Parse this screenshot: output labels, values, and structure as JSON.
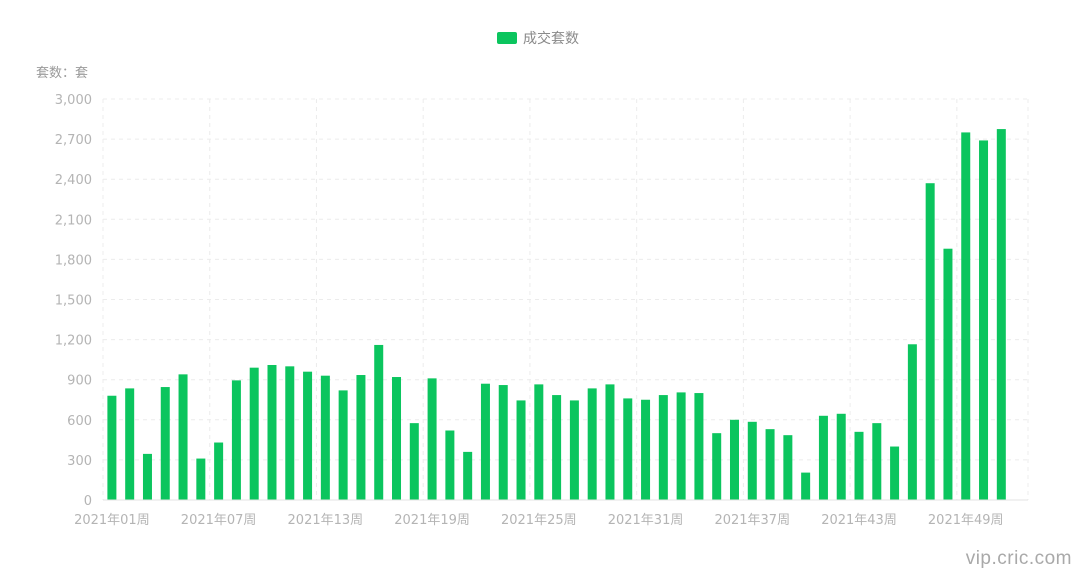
{
  "chart_data": {
    "type": "bar",
    "legend": {
      "label": "成交套数",
      "position": "top-center"
    },
    "unit_label": "套数：套",
    "grid": true,
    "ylim": [
      0,
      3000
    ],
    "y_ticks": [
      "0",
      "300",
      "600",
      "900",
      "1,200",
      "1,500",
      "1,800",
      "2,100",
      "2,400",
      "2,700",
      "3,000"
    ],
    "x_tick_labels": [
      "2021年01周",
      "2021年07周",
      "2021年13周",
      "2021年19周",
      "2021年25周",
      "2021年31周",
      "2021年37周",
      "2021年43周",
      "2021年49周"
    ],
    "categories": [
      "2021年01周",
      "2021年02周",
      "2021年03周",
      "2021年04周",
      "2021年05周",
      "2021年06周",
      "2021年07周",
      "2021年08周",
      "2021年09周",
      "2021年10周",
      "2021年11周",
      "2021年12周",
      "2021年13周",
      "2021年14周",
      "2021年15周",
      "2021年16周",
      "2021年17周",
      "2021年18周",
      "2021年19周",
      "2021年20周",
      "2021年21周",
      "2021年22周",
      "2021年23周",
      "2021年24周",
      "2021年25周",
      "2021年26周",
      "2021年27周",
      "2021年28周",
      "2021年29周",
      "2021年30周",
      "2021年31周",
      "2021年32周",
      "2021年33周",
      "2021年34周",
      "2021年35周",
      "2021年36周",
      "2021年37周",
      "2021年38周",
      "2021年39周",
      "2021年40周",
      "2021年41周",
      "2021年42周",
      "2021年43周",
      "2021年44周",
      "2021年45周",
      "2021年46周",
      "2021年47周",
      "2021年48周",
      "2021年49周",
      "2021年50周",
      "2021年51周",
      "2021年52周"
    ],
    "series": [
      {
        "name": "成交套数",
        "values": [
          780,
          835,
          345,
          845,
          940,
          310,
          430,
          895,
          990,
          1010,
          1000,
          960,
          930,
          820,
          935,
          1160,
          920,
          575,
          910,
          520,
          360,
          870,
          860,
          745,
          865,
          785,
          745,
          835,
          865,
          760,
          750,
          785,
          805,
          800,
          500,
          600,
          585,
          530,
          485,
          205,
          630,
          645,
          510,
          575,
          400,
          1165,
          2370,
          1880,
          2750,
          2690,
          2775,
          0
        ]
      }
    ],
    "colors": {
      "bar": "#0bc55e",
      "grid": "#ececec",
      "axis_text": "#b4b4b4"
    }
  },
  "watermark": "vip.cric.com"
}
